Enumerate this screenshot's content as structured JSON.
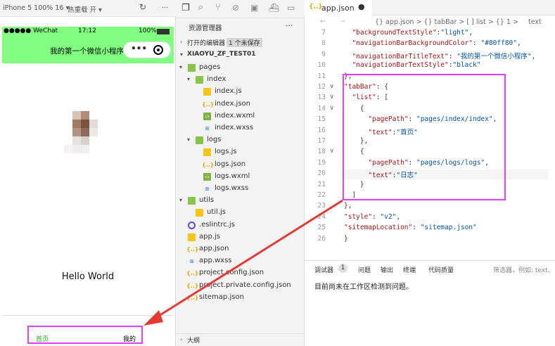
{
  "simulator": {
    "device": "iPhone 5 100% 16 ▾",
    "hot_reload": "热重载 开 ▾",
    "status_carrier": "●●●●● WeChat",
    "status_time": "17:12",
    "status_battery": "100%",
    "nav_title": "我的第一个微信小程序",
    "hello_text": "Hello World",
    "tabbar_items": [
      "首页",
      "我的"
    ]
  },
  "explorer": {
    "title": "资源管理器",
    "more": "···",
    "open_editors": "打开的编辑器",
    "unsaved": "1 个未保存",
    "project": "XIAOYU_ZF_TEST01",
    "tree": [
      {
        "label": "pages",
        "kind": "folder",
        "indent": 1,
        "open": true
      },
      {
        "label": "index",
        "kind": "folder",
        "indent": 2,
        "open": true
      },
      {
        "label": "index.js",
        "kind": "js",
        "indent": 3
      },
      {
        "label": "index.json",
        "kind": "json",
        "indent": 3
      },
      {
        "label": "index.wxml",
        "kind": "wxml",
        "indent": 3
      },
      {
        "label": "index.wxss",
        "kind": "wxss",
        "indent": 3
      },
      {
        "label": "logs",
        "kind": "folder",
        "indent": 2,
        "open": true
      },
      {
        "label": "logs.js",
        "kind": "js",
        "indent": 3
      },
      {
        "label": "logs.json",
        "kind": "json",
        "indent": 3
      },
      {
        "label": "logs.wxml",
        "kind": "wxml",
        "indent": 3
      },
      {
        "label": "logs.wxss",
        "kind": "wxss",
        "indent": 3
      },
      {
        "label": "utils",
        "kind": "folder",
        "indent": 1,
        "open": true
      },
      {
        "label": "util.js",
        "kind": "js",
        "indent": 2
      },
      {
        "label": ".eslintrc.js",
        "kind": "eslint",
        "indent": 1
      },
      {
        "label": "app.js",
        "kind": "js",
        "indent": 1
      },
      {
        "label": "app.json",
        "kind": "json",
        "indent": 1
      },
      {
        "label": "app.wxss",
        "kind": "wxss",
        "indent": 1
      },
      {
        "label": "project.config.json",
        "kind": "json",
        "indent": 1
      },
      {
        "label": "project.private.config.json",
        "kind": "json",
        "indent": 1
      },
      {
        "label": "sitemap.json",
        "kind": "json",
        "indent": 1
      }
    ],
    "outline": "大纲"
  },
  "editor": {
    "tab_label": "app.json",
    "breadcrumb": "{} app.json > {} tabBar > [ ] list > {} 1 > ",
    "breadcrumb_leaf": "text",
    "lines": [
      {
        "n": "7",
        "text": "  \"backgroundTextStyle\":\"light\","
      },
      {
        "n": "8",
        "text": "  \"navigationBarBackgroundColor\": \"#80ff80\","
      },
      {
        "n": "9",
        "text": "  \"navigationBarTitleText\": \"我的第一个微信小程序\","
      },
      {
        "n": "10",
        "text": "  \"navigationBarTextStyle\":\"black\""
      },
      {
        "n": "11",
        "text": "},"
      },
      {
        "n": "12",
        "text": "\"tabBar\": {"
      },
      {
        "n": "13",
        "text": "  \"list\": ["
      },
      {
        "n": "14",
        "text": "    {"
      },
      {
        "n": "15",
        "text": "      \"pagePath\": \"pages/index/index\","
      },
      {
        "n": "16",
        "text": "      \"text\":\"首页\""
      },
      {
        "n": "17",
        "text": "    },"
      },
      {
        "n": "18",
        "text": "    {"
      },
      {
        "n": "19",
        "text": "      \"pagePath\": \"pages/logs/logs\","
      },
      {
        "n": "20",
        "text": "      \"text\":\"日志\""
      },
      {
        "n": "21",
        "text": "    }"
      },
      {
        "n": "22",
        "text": "  ]"
      },
      {
        "n": "23",
        "text": "},"
      },
      {
        "n": "24",
        "text": "\"style\": \"v2\","
      },
      {
        "n": "25",
        "text": "\"sitemapLocation\": \"sitemap.json\""
      },
      {
        "n": "26",
        "text": "}"
      }
    ]
  },
  "panel": {
    "tabs": [
      "调试器",
      "1",
      "问题",
      "输出",
      "终端",
      "代码质量"
    ],
    "filter_placeholder": "筛选器，例如: text、**",
    "message": "目前尚未在工作区检测到问题。"
  },
  "colors": {
    "nav_green": "#80ff80",
    "highlight": "#e040fb",
    "arrow": "#e53935"
  }
}
